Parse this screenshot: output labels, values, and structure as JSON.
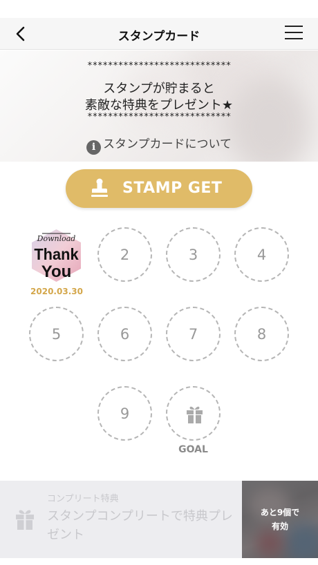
{
  "header": {
    "title": "スタンプカード"
  },
  "banner": {
    "stars_top": "****************************",
    "line1": "スタンプが貯まると",
    "line2": "素敵な特典をプレゼント★",
    "stars_bottom": "****************************",
    "about_link": "スタンプカードについて"
  },
  "stamp_button": {
    "label": "STAMP GET",
    "color": "#e0bb68"
  },
  "stamps": {
    "collected": {
      "image_text_top": "Download",
      "image_text_main1": "Thank",
      "image_text_main2": "You",
      "date": "2020.03.30"
    },
    "slots": [
      "2",
      "3",
      "4",
      "5",
      "6",
      "7",
      "8",
      "9"
    ],
    "goal_label": "GOAL"
  },
  "complete_bonus": {
    "category": "コンプリート特典",
    "text": "スタンプコンプリートで特典プレゼント",
    "remaining_line1": "あと9個で",
    "remaining_line2": "有効"
  }
}
